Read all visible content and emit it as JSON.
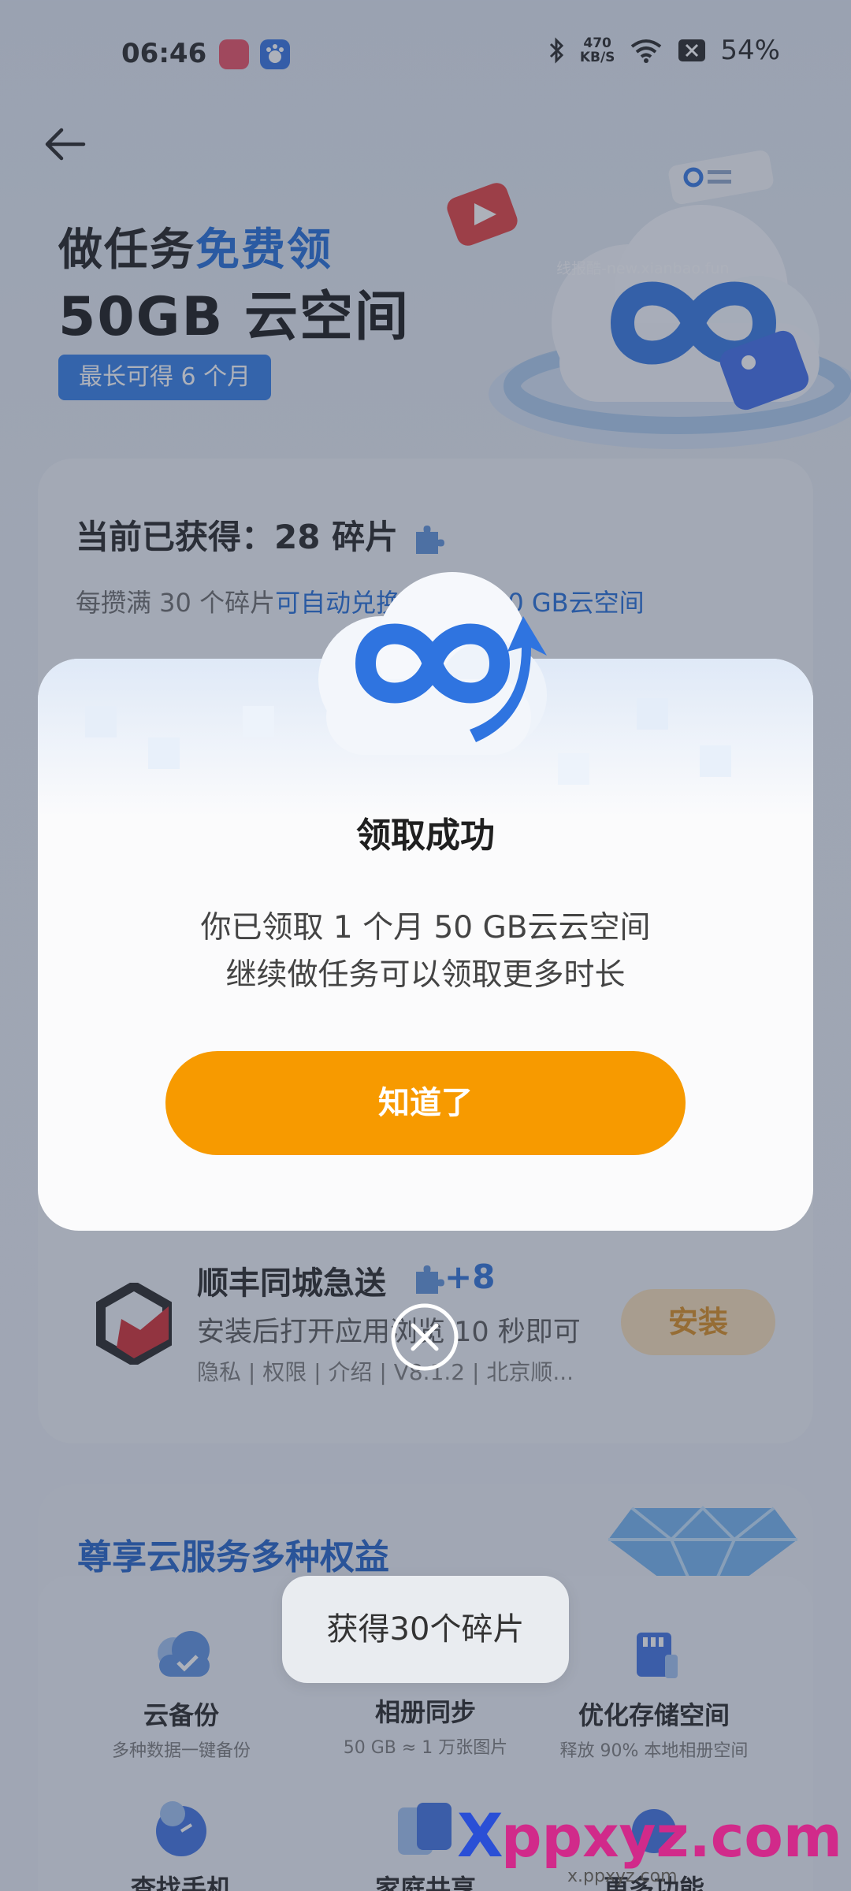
{
  "status_bar": {
    "time": "06:46",
    "speed_value": "470",
    "speed_unit": "KB/S",
    "battery": "54%"
  },
  "header": {
    "title_prefix": "做任务",
    "title_highlight": "免费领",
    "title_line2": "50GB 云空间",
    "badge": "最长可得 6 个月",
    "watermark": "线报酷-new.xianbao.fun"
  },
  "progress": {
    "title": "当前已获得：28 碎片",
    "sub_prefix": "每攒满 30 个碎片",
    "sub_link": "可自动兑换 1 个月 50 GB云空间"
  },
  "task": {
    "name": "顺丰同城急送",
    "reward": "+8",
    "desc": "安装后打开应用浏览 10 秒即可",
    "meta": "隐私 | 权限 | 介绍 | V8.1.2 | 北京顺...",
    "install_label": "安装"
  },
  "benefits": {
    "title": "尊享云服务多种权益",
    "items": [
      {
        "label": "云备份",
        "desc": "多种数据一键备份"
      },
      {
        "label": "相册同步",
        "desc": "50 GB ≈ 1 万张图片"
      },
      {
        "label": "优化存储空间",
        "desc": "释放 90% 本地相册空间"
      },
      {
        "label": "查找手机",
        "desc": ""
      },
      {
        "label": "家庭共享",
        "desc": ""
      },
      {
        "label": "更多功能",
        "desc": ""
      }
    ]
  },
  "modal": {
    "title": "领取成功",
    "line1": "你已领取 1 个月 50 GB云云空间",
    "line2": "继续做任务可以领取更多时长",
    "ok_label": "知道了"
  },
  "toast": {
    "text": "获得30个碎片"
  },
  "bottom_watermark": {
    "brand": "ppxyz.com",
    "sub": "x.ppxyz.com"
  },
  "colors": {
    "accent_blue": "#1e6ad6",
    "ok_orange": "#f79a00",
    "install_bg": "#f6dcb6"
  }
}
